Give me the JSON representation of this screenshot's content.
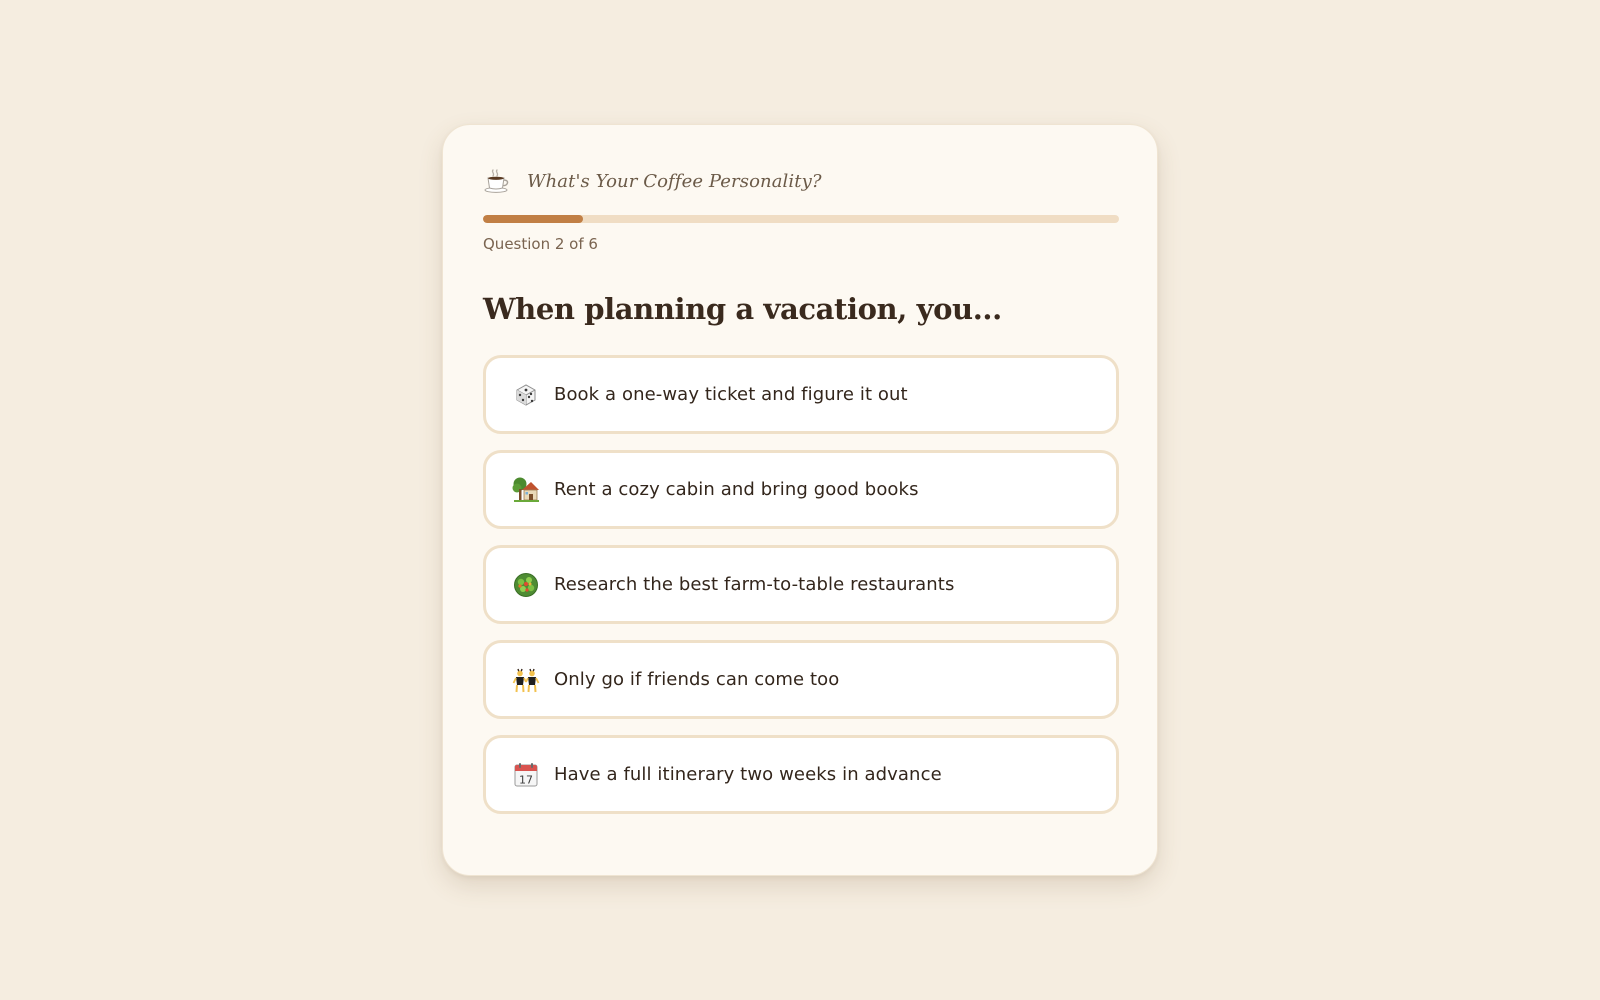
{
  "quiz": {
    "title": "What's Your Coffee Personality?",
    "icon": "coffee-cup-icon",
    "progress": {
      "current": 2,
      "total": 6,
      "fraction": 0.158,
      "label": "Question 2 of 6"
    },
    "question": "When planning a vacation, you...",
    "options": [
      {
        "label": "Book a one-way ticket and figure it out",
        "icon": "dice-icon"
      },
      {
        "label": "Rent a cozy cabin and bring good books",
        "icon": "cabin-icon"
      },
      {
        "label": "Research the best farm-to-table restaurants",
        "icon": "salad-icon"
      },
      {
        "label": "Only go if friends can come too",
        "icon": "friends-icon"
      },
      {
        "label": "Have a full itinerary two weeks in advance",
        "icon": "calendar-icon"
      }
    ]
  },
  "colors": {
    "page_background": "#f5ede0",
    "card_background": "#fdf9f2",
    "accent": "#c17f45",
    "progress_track": "#f0ddc4",
    "option_border": "#efe0c8"
  }
}
